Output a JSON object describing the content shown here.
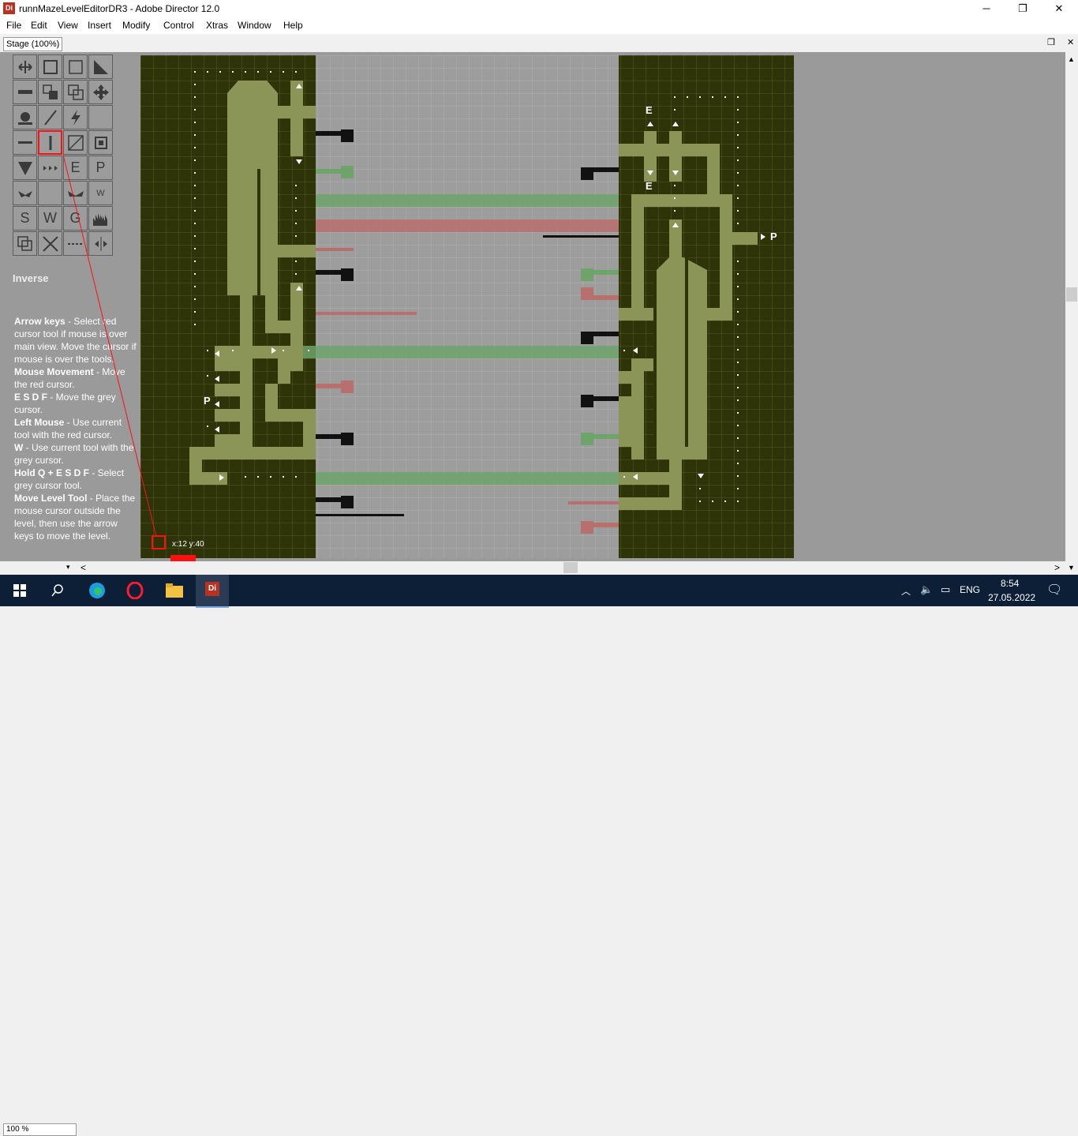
{
  "window": {
    "icon_text": "Di",
    "title": "runnMazeLevelEditorDR3 - Adobe Director 12.0",
    "minimize": "─",
    "maximize": "❐",
    "close": "✕"
  },
  "menu": [
    "File",
    "Edit",
    "View",
    "Insert",
    "Modify",
    "Control",
    "Xtras",
    "Window",
    "Help"
  ],
  "stage": {
    "title": "Stage (100%)",
    "restore": "❐",
    "close": "✕"
  },
  "tools": {
    "mode_label": "Inverse",
    "letters": {
      "e": "E",
      "p": "P",
      "w": "W",
      "s": "S",
      "w2": "W",
      "g": "G"
    }
  },
  "help": [
    {
      "key": "Arrow keys",
      "text": " - Select red cursor tool if mouse is over main view. Move the cursor if mouse is over the tools."
    },
    {
      "key": "Mouse Movement",
      "text": " - Move the red cursor."
    },
    {
      "key": "E S D F",
      "text": " - Move the grey cursor."
    },
    {
      "key": "Left Mouse",
      "text": " - Use current tool with the red cursor."
    },
    {
      "key": "W",
      "text": " - Use current tool with the grey cursor."
    },
    {
      "key": "Hold Q + E S D F",
      "text": " - Select grey cursor tool."
    },
    {
      "key": "Move Level Tool",
      "text": " - Place the mouse cursor outside the level, then use the arrow keys to move the level."
    }
  ],
  "level": {
    "coords": "x:12 y:40",
    "markers": {
      "e1": "E",
      "e2": "E",
      "p1": "P",
      "p2": "P"
    }
  },
  "colors": {
    "maze_bg": "#2e3408",
    "path": "#8c9558",
    "beam_green": "#6ea36a",
    "beam_red": "#b8706e",
    "cursor": "#ff1010"
  },
  "scroll": {
    "zoom_value": "100 %",
    "left": "<",
    "right": ">"
  },
  "taskbar": {
    "time": "8:54",
    "date": "27.05.2022",
    "lang": "ENG",
    "active_app": "Di"
  }
}
